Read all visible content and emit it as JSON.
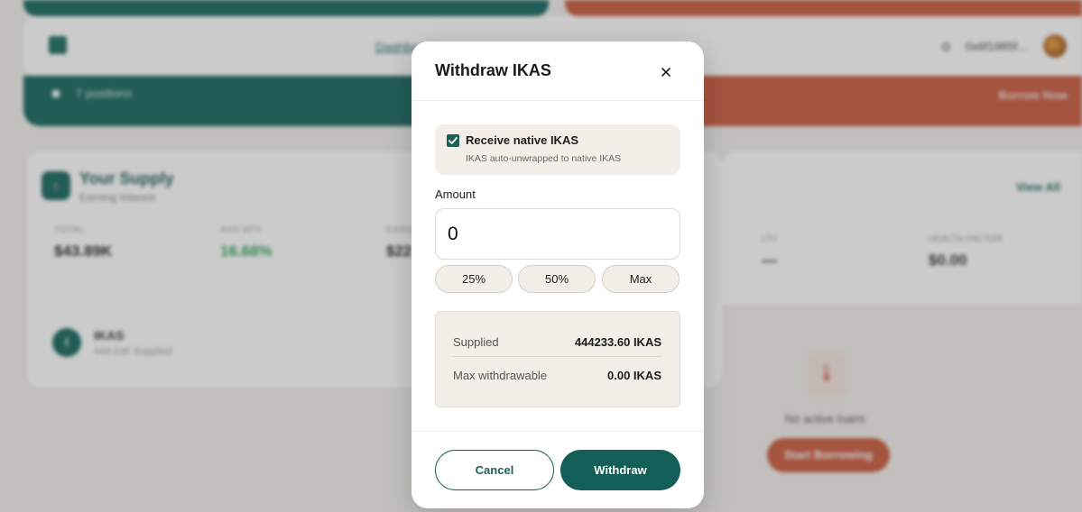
{
  "background": {
    "nav_link": "Dashboard",
    "account": "0x6f1985f...",
    "teal_band_text": "7 positions",
    "orange_band_text": "Borrow Now",
    "supply": {
      "title": "Your Supply",
      "subtitle": "Earning interest",
      "stats": [
        {
          "label": "TOTAL",
          "value": "$43.89K"
        },
        {
          "label": "AVG APY",
          "value": "16.68%"
        },
        {
          "label": "EARNINGS",
          "value": "$22"
        }
      ],
      "asset": {
        "symbol": "IKAS",
        "icon_letter": "I",
        "sub": "444.23K Supplied"
      }
    },
    "borrow": {
      "view_all": "View All",
      "stats": [
        {
          "label": "LTV",
          "value": "—"
        },
        {
          "label": "HEALTH FACTOR",
          "value": "$0.00"
        }
      ],
      "empty_text": "No active loans",
      "start_button": "Start Borrowing"
    }
  },
  "modal": {
    "title": "Withdraw IKAS",
    "native": {
      "checked": true,
      "label": "Receive native IKAS",
      "sub": "IKAS auto-unwrapped to native IKAS"
    },
    "amount": {
      "label": "Amount",
      "value": "0",
      "placeholder": "0"
    },
    "presets": [
      "25%",
      "50%",
      "Max"
    ],
    "info": {
      "supplied_label": "Supplied",
      "supplied_value": "444233.60 IKAS",
      "max_label": "Max withdrawable",
      "max_value": "0.00 IKAS"
    },
    "cancel_label": "Cancel",
    "withdraw_label": "Withdraw"
  },
  "colors": {
    "primary": "#135e58",
    "accent_orange": "#c95a3d",
    "panel_beige": "#f3efe8"
  }
}
